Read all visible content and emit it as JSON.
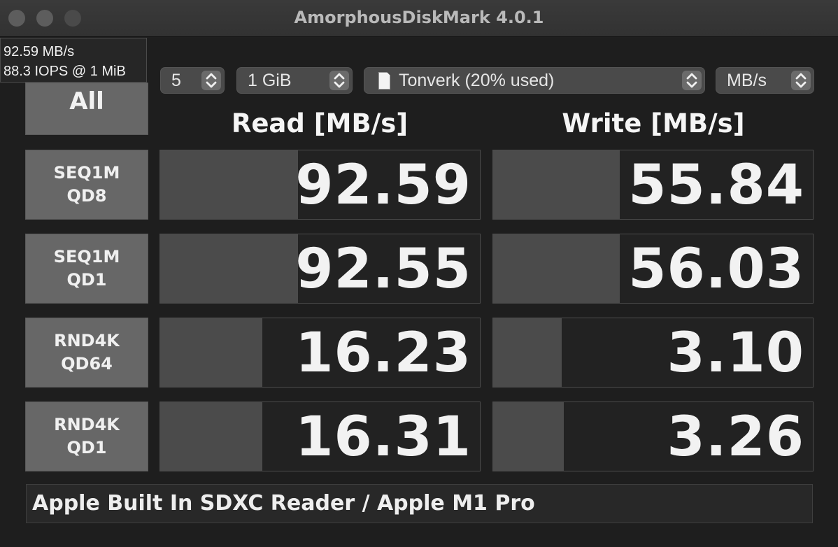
{
  "window": {
    "title": "AmorphousDiskMark 4.0.1"
  },
  "tooltip": {
    "line1": "92.59 MB/s",
    "line2": "88.3 IOPS @ 1 MiB"
  },
  "controls": {
    "all_label": "All",
    "count": "5",
    "size": "1 GiB",
    "drive": "Tonverk (20% used)",
    "unit": "MB/s"
  },
  "headers": {
    "read": "Read [MB/s]",
    "write": "Write [MB/s]"
  },
  "tests": [
    {
      "line1": "SEQ1M",
      "line2": "QD8",
      "read": "92.59",
      "write": "55.84",
      "read_fill": 0.43,
      "write_fill": 0.395
    },
    {
      "line1": "SEQ1M",
      "line2": "QD1",
      "read": "92.55",
      "write": "56.03",
      "read_fill": 0.43,
      "write_fill": 0.395
    },
    {
      "line1": "RND4K",
      "line2": "QD64",
      "read": "16.23",
      "write": "3.10",
      "read_fill": 0.32,
      "write_fill": 0.215
    },
    {
      "line1": "RND4K",
      "line2": "QD1",
      "read": "16.31",
      "write": "3.26",
      "read_fill": 0.32,
      "write_fill": 0.22
    }
  ],
  "footer": {
    "device": "Apple Built In SDXC Reader / Apple M1 Pro"
  }
}
